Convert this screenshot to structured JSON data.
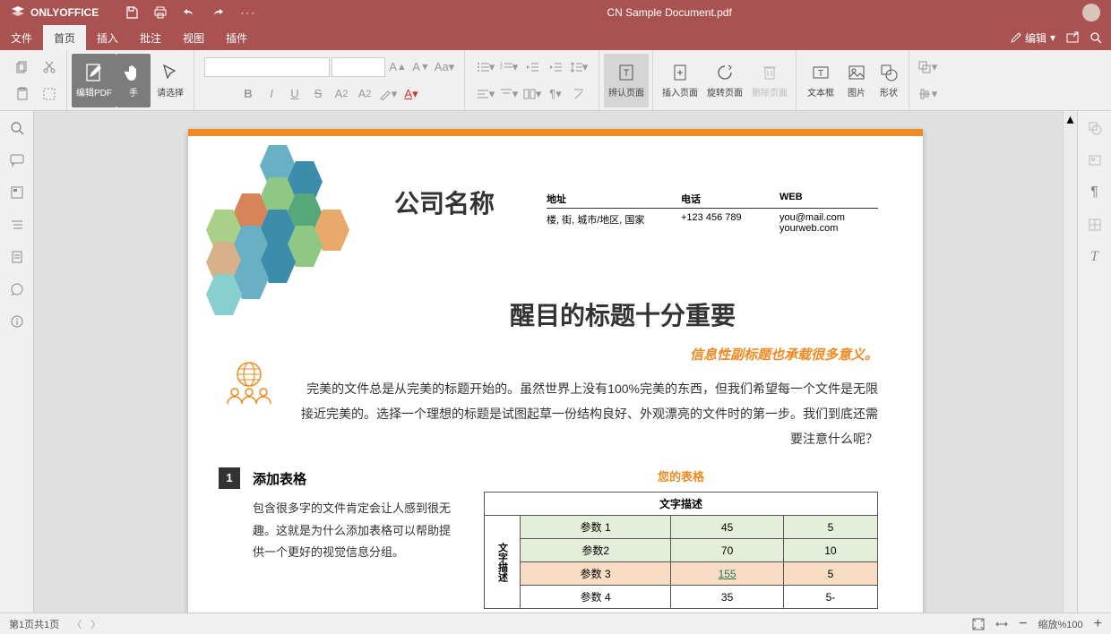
{
  "app": {
    "name": "ONLYOFFICE",
    "doc_title": "CN Sample Document.pdf"
  },
  "menubar": {
    "file": "文件",
    "home": "首页",
    "insert": "插入",
    "comment": "批注",
    "view": "视图",
    "plugins": "插件",
    "edit_mode": "编辑"
  },
  "toolbar": {
    "edit_pdf": "编辑PDF",
    "hand": "手",
    "select": "请选择",
    "recognize": "辨认页面",
    "insert_page": "插入页面",
    "rotate_page": "旋转页面",
    "delete_page": "删除页面",
    "textbox": "文本框",
    "image": "图片",
    "shape": "形状"
  },
  "document": {
    "company": "公司名称",
    "info": {
      "addr_lbl": "地址",
      "addr_val": "楼, 街, 城市/地区, 国家",
      "tel_lbl": "电话",
      "tel_val": "+123 456 789",
      "web_lbl": "WEB",
      "web_val1": "you@mail.com",
      "web_val2": "yourweb.com"
    },
    "headline": "醒目的标题十分重要",
    "subhead": "信息性副标题也承载很多意义。",
    "body": "完美的文件总是从完美的标题开始的。虽然世界上没有100%完美的东西，但我们希望每一个文件是无限接近完美的。选择一个理想的标题是试图起草一份结构良好、外观漂亮的文件时的第一步。我们到底还需要注意什么呢？",
    "sec1_num": "1",
    "sec1_title": "添加表格",
    "sec1_body": "包含很多字的文件肯定会让人感到很无趣。这就是为什么添加表格可以帮助提供一个更好的视觉信息分组。",
    "table_title": "您的表格",
    "table_header": "文字描述",
    "side_label": "文字描述",
    "rows": [
      {
        "p": "参数 1",
        "a": "45",
        "b": "5"
      },
      {
        "p": "参数2",
        "a": "70",
        "b": "10"
      },
      {
        "p": "参数 3",
        "a": "155",
        "b": "5"
      },
      {
        "p": "参数 4",
        "a": "35",
        "b": "5-"
      }
    ]
  },
  "status": {
    "page": "第1页共1页",
    "zoom": "缩放%100"
  }
}
